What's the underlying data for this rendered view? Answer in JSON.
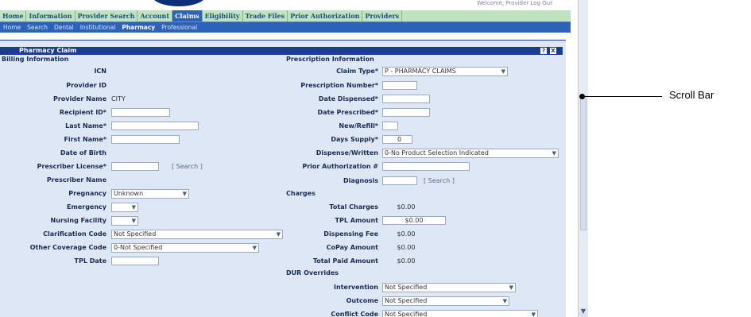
{
  "header": {
    "top_right_text": "Welcome, Provider  Log Out"
  },
  "top_nav": [
    "Home",
    "Information",
    "Provider Search",
    "Account",
    "Claims",
    "Eligibility",
    "Trade Files",
    "Prior Authorization",
    "Providers"
  ],
  "sub_nav": [
    "Home",
    "Search",
    "Dental",
    "Institutional",
    "Pharmacy",
    "Professional"
  ],
  "panel": {
    "title": "Pharmacy Claim",
    "help_btn": "?",
    "close_btn": "X"
  },
  "billing": {
    "heading": "Billing Information",
    "icn_label": "ICN",
    "provider_id_label": "Provider ID",
    "provider_name_label": "Provider Name",
    "provider_name_value": "CITY",
    "recipient_id_label": "Recipient ID*",
    "last_name_label": "Last Name*",
    "first_name_label": "First Name*",
    "dob_label": "Date of Birth",
    "prescriber_license_label": "Prescriber License*",
    "prescriber_search": "[ Search ]",
    "prescriber_name_label": "Prescriber Name",
    "pregnancy_label": "Pregnancy",
    "pregnancy_value": "Unknown",
    "emergency_label": "Emergency",
    "nursing_label": "Nursing Facility",
    "clarification_label": "Clarification Code",
    "clarification_value": "Not Specified",
    "other_coverage_label": "Other Coverage Code",
    "other_coverage_value": "0-Not Specified",
    "tpl_date_label": "TPL Date"
  },
  "prescription": {
    "heading": "Prescription Information",
    "claim_type_label": "Claim Type*",
    "claim_type_value": "P - PHARMACY CLAIMS",
    "rx_number_label": "Prescription Number*",
    "date_dispensed_label": "Date Dispensed*",
    "date_prescribed_label": "Date Prescribed*",
    "new_refill_label": "New/Refill*",
    "days_supply_label": "Days Supply*",
    "days_supply_value": "0",
    "dispense_written_label": "Dispense/Written",
    "dispense_written_value": "0-No Product Selection Indicated",
    "prior_auth_label": "Prior Authorization #",
    "diagnosis_label": "Diagnosis",
    "diagnosis_search": "[ Search ]"
  },
  "charges": {
    "heading": "Charges",
    "total_charges_label": "Total Charges",
    "total_charges_value": "$0.00",
    "tpl_amount_label": "TPL Amount",
    "tpl_amount_value": "$0.00",
    "dispensing_fee_label": "Dispensing Fee",
    "dispensing_fee_value": "$0.00",
    "copay_label": "CoPay Amount",
    "copay_value": "$0.00",
    "total_paid_label": "Total Paid Amount",
    "total_paid_value": "$0.00"
  },
  "dur": {
    "heading": "DUR Overrides",
    "intervention_label": "Intervention",
    "intervention_value": "Not Specified",
    "outcome_label": "Outcome",
    "outcome_value": "Not Specified",
    "conflict_label": "Conflict Code",
    "conflict_value": "Not Specified"
  },
  "callout": {
    "label": "Scroll Bar"
  },
  "colors": {
    "nav_green": "#bfe3bf",
    "nav_blue": "#2e62b8",
    "panel_bg": "#dde7f6",
    "header_navy": "#1b3c90"
  }
}
